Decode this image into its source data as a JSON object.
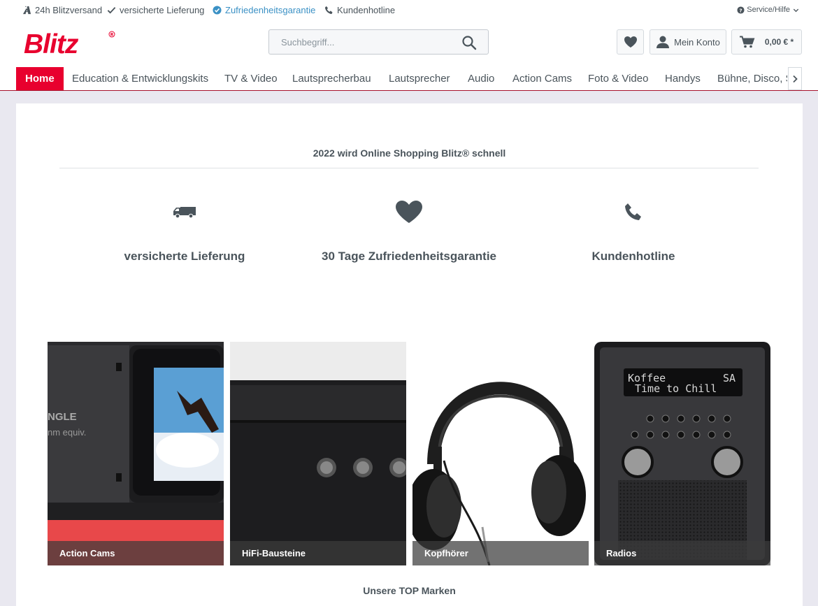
{
  "topbar": {
    "usps": [
      {
        "icon": "road-icon",
        "text": "24h Blitzversand"
      },
      {
        "icon": "check-icon",
        "text": "versicherte Lieferung"
      },
      {
        "icon": "check-circle-icon",
        "text": "Zufriedenheitsgarantie"
      },
      {
        "icon": "phone-icon",
        "text": "Kundenhotline"
      }
    ],
    "service_label": "Service/Hilfe"
  },
  "header": {
    "logo_text": "Blitz",
    "search_placeholder": "Suchbegriff...",
    "account_label": "Mein Konto",
    "cart_total": "0,00 € *"
  },
  "nav": {
    "items": [
      "Home",
      "Education & Entwicklungskits",
      "TV & Video",
      "Lautsprecherbau",
      "Lautsprecher",
      "Audio",
      "Action Cams",
      "Foto & Video",
      "Handys",
      "Bühne, Disco, S"
    ]
  },
  "intro": {
    "title": "2022 wird Online Shopping Blitz® schnell",
    "features": [
      {
        "icon": "truck-icon",
        "label": "versicherte Lieferung"
      },
      {
        "icon": "heart-icon",
        "label": "30 Tage Zufriedenheitsgarantie"
      },
      {
        "icon": "phone-icon",
        "label": "Kundenhotline"
      }
    ]
  },
  "categories": [
    {
      "label": "Action Cams"
    },
    {
      "label": "HiFi-Bausteine"
    },
    {
      "label": "Kopfhörer"
    },
    {
      "label": "Radios"
    }
  ],
  "radio_display": {
    "line1": "Koffee",
    "station": "SA",
    "line2": "Time to Chill"
  },
  "camera_text": {
    "line1": "NGLE",
    "line2": "nm  equiv."
  },
  "brands_title": "Unsere TOP Marken",
  "colors": {
    "brand": "#e8002e",
    "accent_blue": "#3b91c5",
    "text": "#4a545b"
  }
}
